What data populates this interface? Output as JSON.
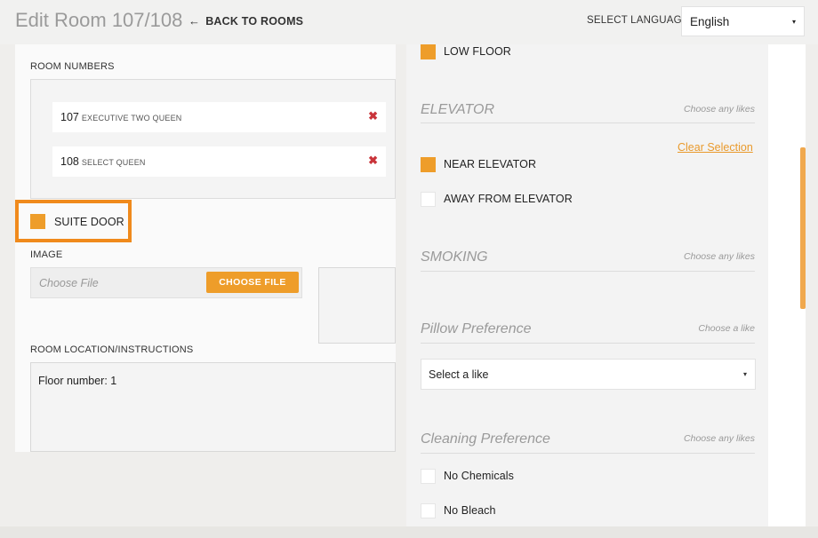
{
  "header": {
    "title": "Edit Room 107/108",
    "back_arrow": "←",
    "back_label": "BACK TO ROOMS",
    "language_label": "SELECT LANGUAGE",
    "language_value": "English",
    "caret": "▾"
  },
  "left": {
    "room_numbers_label": "ROOM NUMBERS",
    "rooms": [
      {
        "number": "107",
        "type": "EXECUTIVE TWO QUEEN",
        "remove": "✖"
      },
      {
        "number": "108",
        "type": "SELECT QUEEN",
        "remove": "✖"
      }
    ],
    "suite_door": {
      "label": "SUITE DOOR",
      "checked": true
    },
    "image_label": "IMAGE",
    "file_placeholder": "Choose File",
    "choose_file_button": "CHOOSE FILE",
    "location_label": "ROOM LOCATION/INSTRUCTIONS",
    "location_value": "Floor number: 1"
  },
  "right": {
    "low_floor": {
      "label": "LOW FLOOR",
      "checked": true
    },
    "elevator": {
      "title": "ELEVATOR",
      "hint": "Choose any likes",
      "clear": "Clear Selection",
      "options": [
        {
          "label": "NEAR ELEVATOR",
          "checked": true
        },
        {
          "label": "AWAY FROM ELEVATOR",
          "checked": false
        }
      ]
    },
    "smoking": {
      "title": "SMOKING",
      "hint": "Choose any likes"
    },
    "pillow": {
      "title": "Pillow Preference",
      "hint": "Choose a like",
      "select_value": "Select a like"
    },
    "cleaning": {
      "title": "Cleaning Preference",
      "hint": "Choose any likes",
      "options": [
        {
          "label": "No Chemicals",
          "checked": false
        },
        {
          "label": "No Bleach",
          "checked": false
        }
      ]
    }
  },
  "colors": {
    "accent": "#ee9d2a",
    "highlight_border": "#f08a1c",
    "remove_x": "#c9343a",
    "page_bg": "#efeeec"
  },
  "icons": {
    "back": "arrow-left-icon",
    "remove": "remove-x-icon",
    "dropdown": "chevron-down-icon"
  }
}
